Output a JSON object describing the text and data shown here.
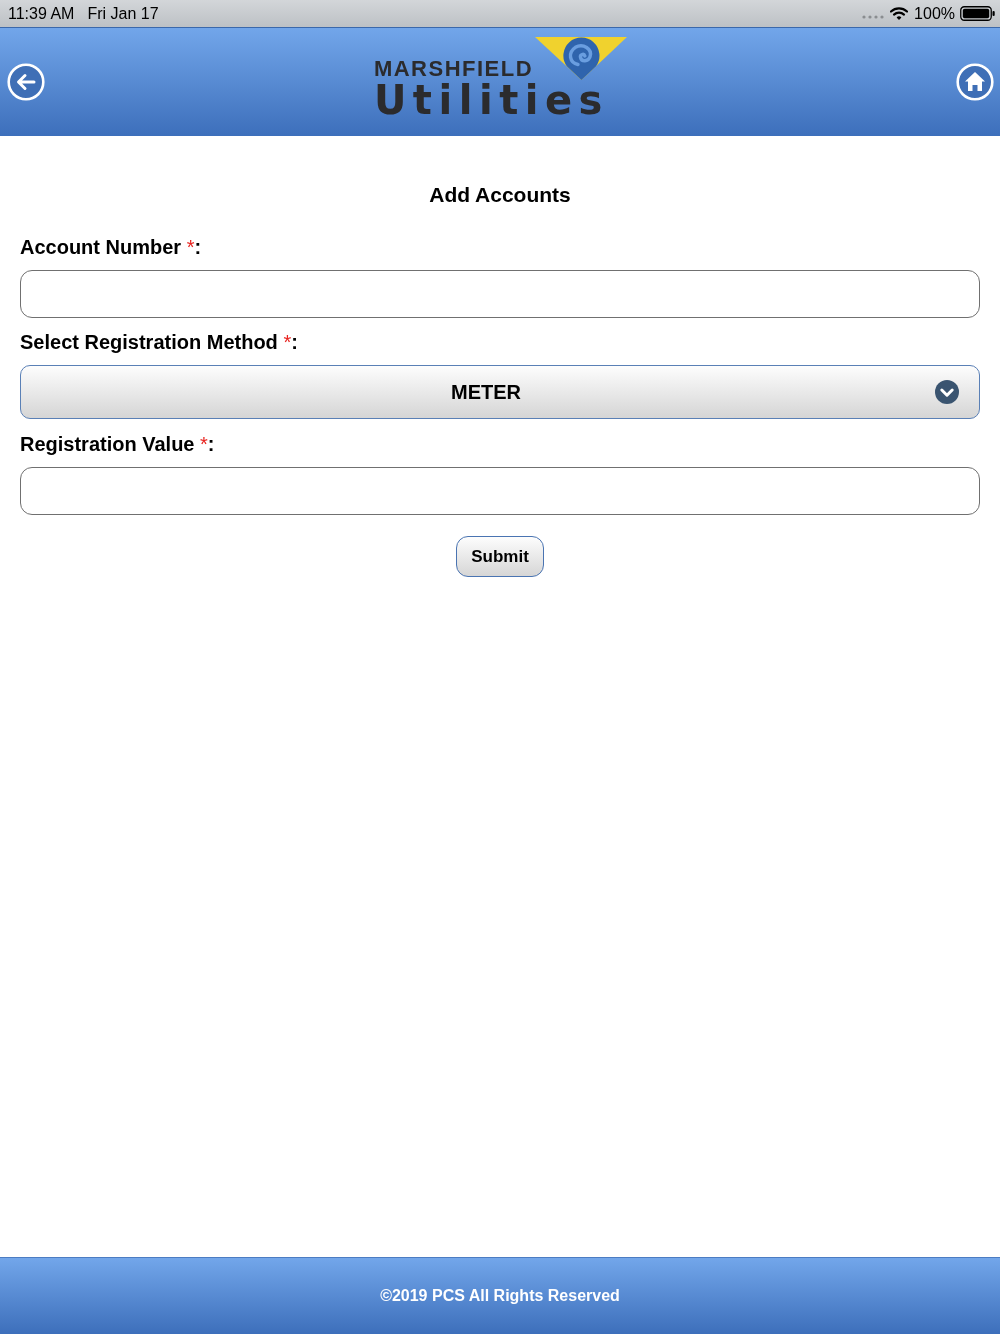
{
  "status_bar": {
    "time": "11:39 AM",
    "date": "Fri Jan 17",
    "battery": "100%"
  },
  "header": {
    "logo": {
      "top_line": "MARSHFIELD",
      "bottom_line": "Utilities"
    }
  },
  "form": {
    "title": "Add Accounts",
    "fields": [
      {
        "kind": "text",
        "label": "Account Number",
        "required_mark": "*",
        "label_suffix": ":"
      },
      {
        "kind": "select",
        "label": "Select Registration Method",
        "required_mark": "*",
        "label_suffix": ":",
        "value": "METER"
      },
      {
        "kind": "text",
        "label": "Registration Value",
        "required_mark": "*",
        "label_suffix": ":"
      }
    ],
    "submit": "Submit"
  },
  "footer": {
    "copyright": "©2019 PCS All Rights Reserved"
  }
}
